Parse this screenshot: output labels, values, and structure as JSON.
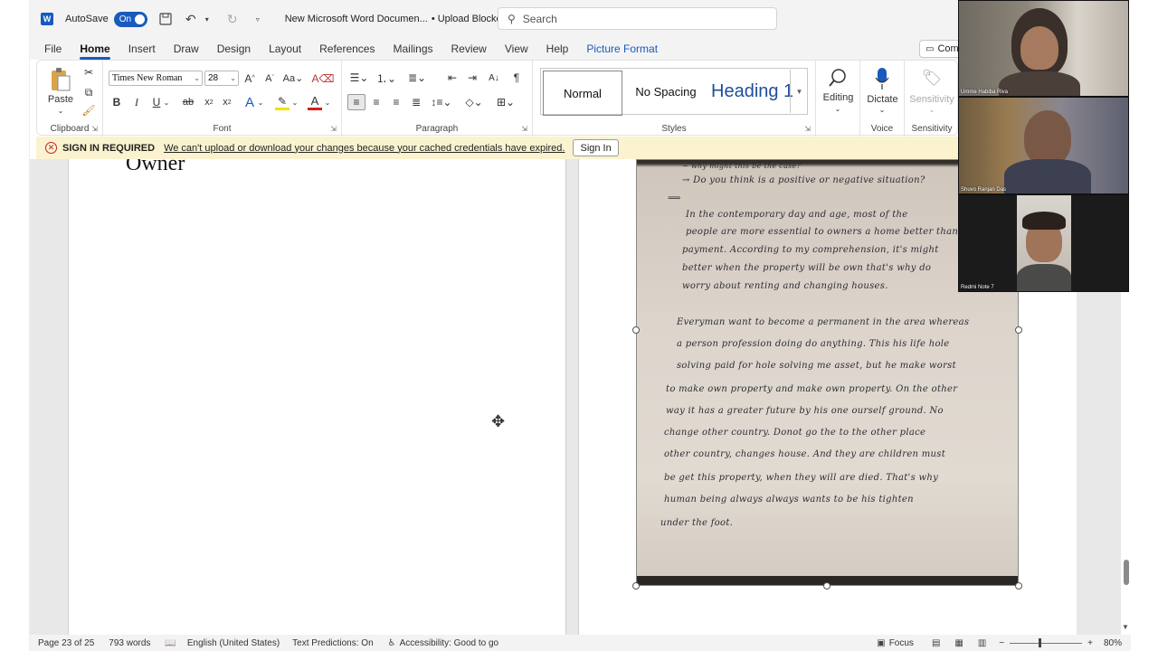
{
  "titlebar": {
    "app_logo": "W",
    "autosave_label": "AutoSave",
    "autosave_state": "On",
    "doc_title": "New Microsoft Word Documen...",
    "doc_status": "• Upload Blocked",
    "search_placeholder": "Search"
  },
  "menu": {
    "tabs": [
      "File",
      "Home",
      "Insert",
      "Draw",
      "Design",
      "Layout",
      "References",
      "Mailings",
      "Review",
      "View",
      "Help",
      "Picture Format"
    ],
    "comments_label": "Comm"
  },
  "ribbon": {
    "clipboard": {
      "paste_label": "Paste",
      "group_label": "Clipboard"
    },
    "font": {
      "font_name": "Times New Roman",
      "font_size": "28",
      "group_label": "Font"
    },
    "paragraph": {
      "group_label": "Paragraph"
    },
    "styles": {
      "items": [
        "Normal",
        "No Spacing",
        "Heading 1"
      ],
      "group_label": "Styles"
    },
    "editing": {
      "label": "Editing"
    },
    "voice": {
      "dictate_label": "Dictate",
      "group_label": "Voice"
    },
    "sensitivity": {
      "label": "Sensitivity",
      "group_label": "Sensitivity"
    }
  },
  "banner": {
    "title": "SIGN IN REQUIRED",
    "message": "We can't upload or download your changes because your cached credentials have expired.",
    "button": "Sign In"
  },
  "document": {
    "heading_text": "Owner",
    "handwriting_lines": [
      "~ why might this be the case?",
      "→ Do you think is a positive or negative situation?",
      "⟹",
      "In the contemporary day and age, most of the",
      "people are more essential to owners a home better than",
      "payment. According to my comprehension, it's might",
      "better when the property will be own that's why do",
      "worry about renting and changing houses.",
      "",
      "Everyman want to become a permanent in the area whereas",
      "a person profession doing do anything. This his life hole",
      "solving paid for hole solving me asset, but he make worst",
      "to make own property and make own property. On the other",
      "way it has a greater future by his one ourself ground. No",
      "change other country. Donot go the to the other place",
      "other country, changes house. And they are children must",
      "be get this property, when they will are died. That's why",
      "human being always always wants to be his tighten",
      "under the foot."
    ]
  },
  "video": {
    "participants": [
      "Umme Habiba Riva",
      "Shuvo Ranjan Das",
      "Redmi Note 7"
    ]
  },
  "statusbar": {
    "page": "Page 23 of 25",
    "words": "793 words",
    "language": "English (United States)",
    "predictions": "Text Predictions: On",
    "accessibility": "Accessibility: Good to go",
    "focus": "Focus",
    "zoom": "80%"
  },
  "colors": {
    "accent": "#185abd",
    "banner_bg": "#fbf3d0",
    "error_red": "#b32424"
  }
}
